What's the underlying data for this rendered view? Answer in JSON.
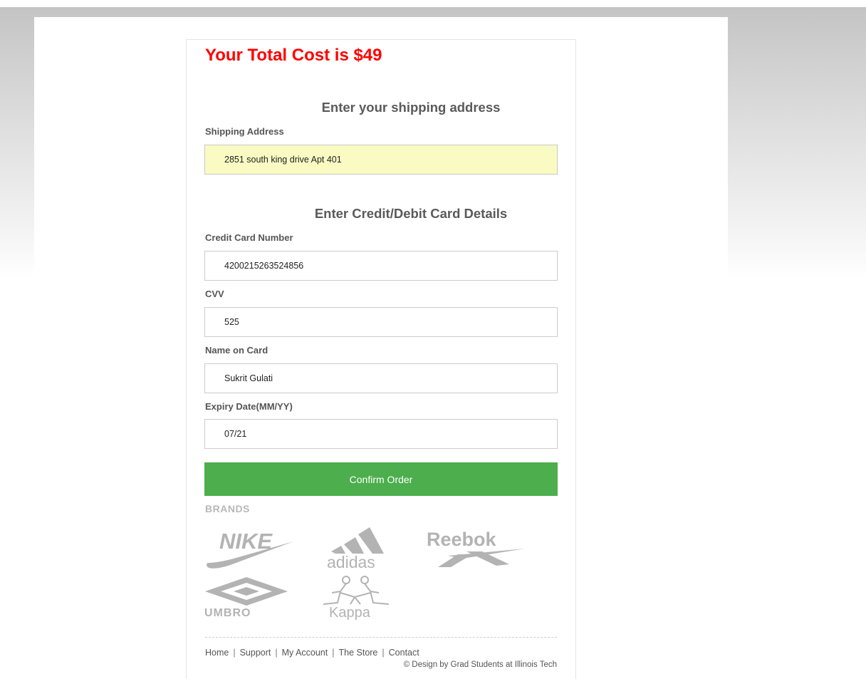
{
  "total_cost": "Your Total Cost is $49",
  "shipping": {
    "heading": "Enter your shipping address",
    "address_label": "Shipping Address",
    "address_value": "2851 south king drive Apt 401"
  },
  "card": {
    "heading": "Enter Credit/Debit Card Details",
    "number_label": "Credit Card Number",
    "number_value": "4200215263524856",
    "cvv_label": "CVV",
    "cvv_value": "525",
    "name_label": "Name on Card",
    "name_value": "Sukrit Gulati",
    "expiry_label": "Expiry Date(MM/YY)",
    "expiry_value": "07/21"
  },
  "confirm_label": "Confirm Order",
  "brands": {
    "heading": "BRANDS",
    "items": [
      {
        "name": "NIKE",
        "icon": "nike-logo-icon"
      },
      {
        "name": "adidas",
        "icon": "adidas-logo-icon"
      },
      {
        "name": "Reebok",
        "icon": "reebok-logo-icon"
      },
      {
        "name": "UMBRO",
        "icon": "umbro-logo-icon"
      },
      {
        "name": "Kappa",
        "icon": "kappa-logo-icon"
      }
    ]
  },
  "footer": {
    "links": [
      "Home",
      "Support",
      "My Account",
      "The Store",
      "Contact"
    ],
    "separator": "|",
    "credit": "© Design by Grad Students at Illinois Tech"
  },
  "colors": {
    "total_cost": "#ff0000",
    "confirm_button": "#4cae4c",
    "autofill_background": "#fafbc2",
    "brand_gray": "#b3b3b3"
  }
}
